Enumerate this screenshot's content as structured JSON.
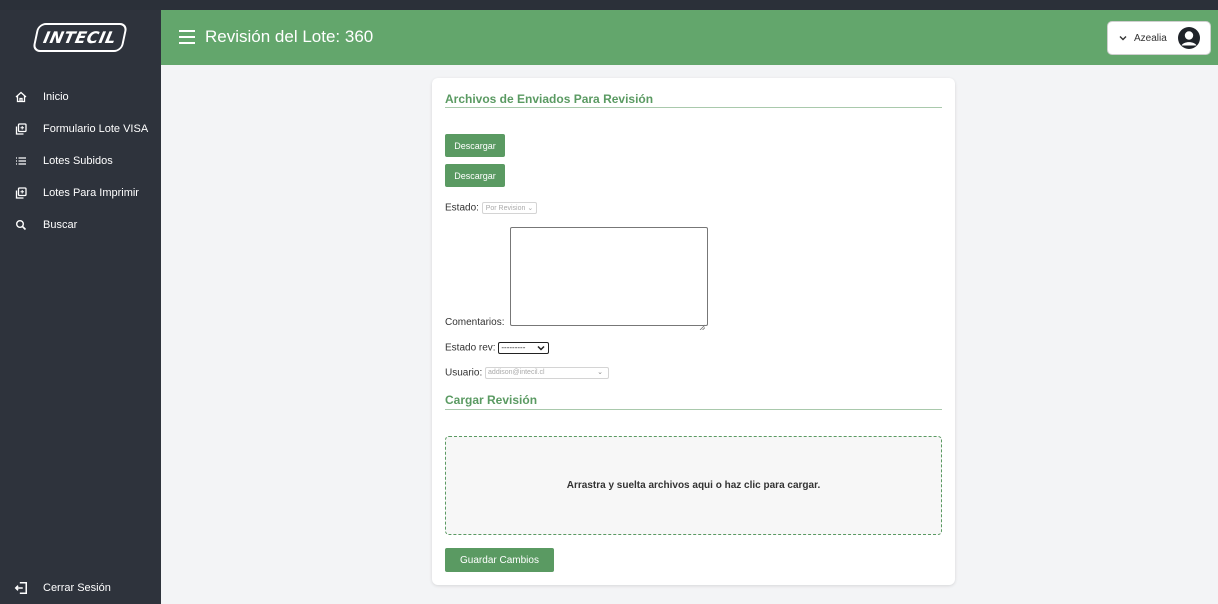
{
  "brand": {
    "logo_text": "INTECIL"
  },
  "header": {
    "title": "Revisión del Lote: 360",
    "user_name": "Azealia"
  },
  "sidebar": {
    "items": [
      {
        "label": "Inicio",
        "icon": "home-icon"
      },
      {
        "label": "Formulario Lote VISA",
        "icon": "copy-icon"
      },
      {
        "label": "Lotes Subidos",
        "icon": "list-icon"
      },
      {
        "label": "Lotes Para Imprimir",
        "icon": "copy-icon"
      },
      {
        "label": "Buscar",
        "icon": "search-icon"
      }
    ],
    "logout_label": "Cerrar Sesión"
  },
  "form": {
    "files_title": "Archivos de Enviados Para Revisión",
    "download_label": "Descargar",
    "estado_label": "Estado:",
    "estado_value": "Por Revision",
    "comentarios_label": "Comentarios:",
    "estado_rev_label": "Estado rev:",
    "estado_rev_value": "---------",
    "usuario_label": "Usuario:",
    "usuario_value": "addison@intecil.cl",
    "upload_title": "Cargar Revisión",
    "dropzone_text": "Arrastra y suelta archivos aqui o haz clic para cargar.",
    "save_label": "Guardar Cambios"
  },
  "colors": {
    "accent": "#63a66c",
    "button": "#5a9a62",
    "sidebar": "#2e333c"
  }
}
